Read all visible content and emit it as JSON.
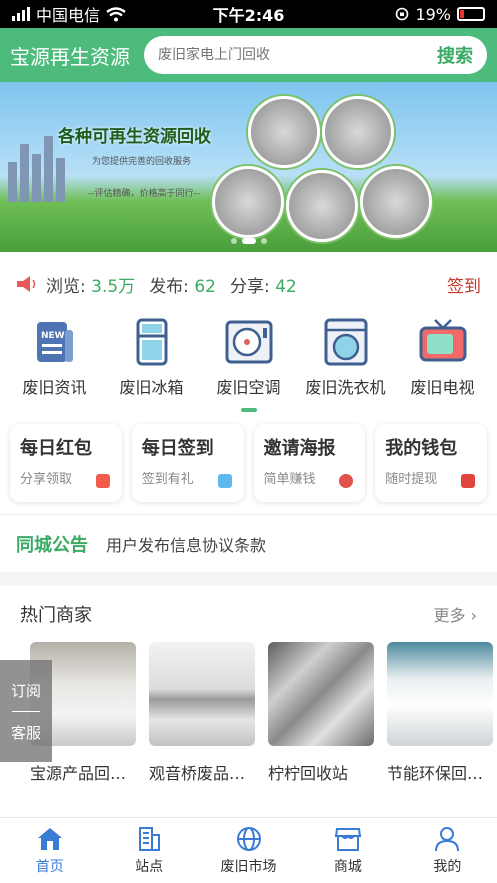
{
  "status_bar": {
    "carrier": "中国电信",
    "time": "下午2:46",
    "battery": "19%",
    "battery_level": 0.19
  },
  "header": {
    "title": "宝源再生资源",
    "search_placeholder": "废旧家电上门回收",
    "search_button": "搜索"
  },
  "banner": {
    "title": "各种可再生资源回收",
    "subtitle1": "为您提供完善的回收服务",
    "subtitle2": "--评估精确，价格高于同行--",
    "slide_count": 3,
    "active_slide": 1
  },
  "stats": {
    "views_label": "浏览:",
    "views_value": "3.5万",
    "posts_label": "发布:",
    "posts_value": "62",
    "shares_label": "分享:",
    "shares_value": "42",
    "signin_label": "签到"
  },
  "categories": [
    {
      "label": "废旧资讯",
      "icon": "news-icon"
    },
    {
      "label": "废旧冰箱",
      "icon": "fridge-icon"
    },
    {
      "label": "废旧空调",
      "icon": "air-conditioner-icon"
    },
    {
      "label": "废旧洗衣机",
      "icon": "washing-machine-icon"
    },
    {
      "label": "废旧电视",
      "icon": "tv-icon"
    }
  ],
  "active_category": 2,
  "cards": [
    {
      "title": "每日红包",
      "sub": "分享领取",
      "icon": "red-packet-icon",
      "color": "#f25a4a"
    },
    {
      "title": "每日签到",
      "sub": "签到有礼",
      "icon": "gift-icon",
      "color": "#5fb8f0"
    },
    {
      "title": "邀请海报",
      "sub": "简单赚钱",
      "icon": "money-bag-icon",
      "color": "#e0524a"
    },
    {
      "title": "我的钱包",
      "sub": "随时提现",
      "icon": "wallet-icon",
      "color": "#e2453c"
    }
  ],
  "notice": {
    "tag": "同城公告",
    "text": "用户发布信息协议条款"
  },
  "hot": {
    "title": "热门商家",
    "more": "更多",
    "merchants": [
      {
        "name": "宝源产品回收站"
      },
      {
        "name": "观音桥废品回收站"
      },
      {
        "name": "柠柠回收站"
      },
      {
        "name": "节能环保回收站"
      }
    ]
  },
  "float": {
    "subscribe": "订阅",
    "service": "客服"
  },
  "tabbar": [
    {
      "label": "首页",
      "icon": "home-icon"
    },
    {
      "label": "站点",
      "icon": "building-icon"
    },
    {
      "label": "废旧市场",
      "icon": "globe-icon"
    },
    {
      "label": "商城",
      "icon": "shop-icon"
    },
    {
      "label": "我的",
      "icon": "user-icon"
    }
  ],
  "active_tab": 0,
  "colors": {
    "brand": "#4dbb7b",
    "accent_text": "#3aaa64",
    "active_tab": "#3a7bd5",
    "signin": "#c0392b"
  }
}
